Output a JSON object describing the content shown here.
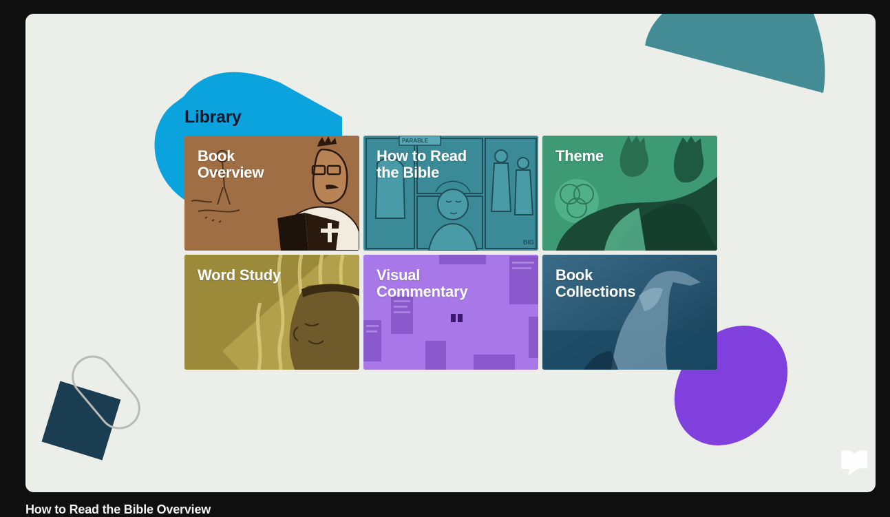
{
  "slide": {
    "heading": "Library",
    "tiles": [
      {
        "label": "Book\nOverview",
        "color": "#a06e44"
      },
      {
        "label": "How to Read\nthe Bible",
        "color": "#3a8a98"
      },
      {
        "label": "Theme",
        "color": "#3d9a74"
      },
      {
        "label": "Word Study",
        "color": "#9a8a3a"
      },
      {
        "label": "Visual\nCommentary",
        "color": "#a878e8"
      },
      {
        "label": "Book\nCollections",
        "color": "#245a78"
      }
    ]
  },
  "video": {
    "title": "How to Read the Bible Overview"
  },
  "icons": [
    "open-book-logo-icon",
    "quote-mark-icon"
  ]
}
